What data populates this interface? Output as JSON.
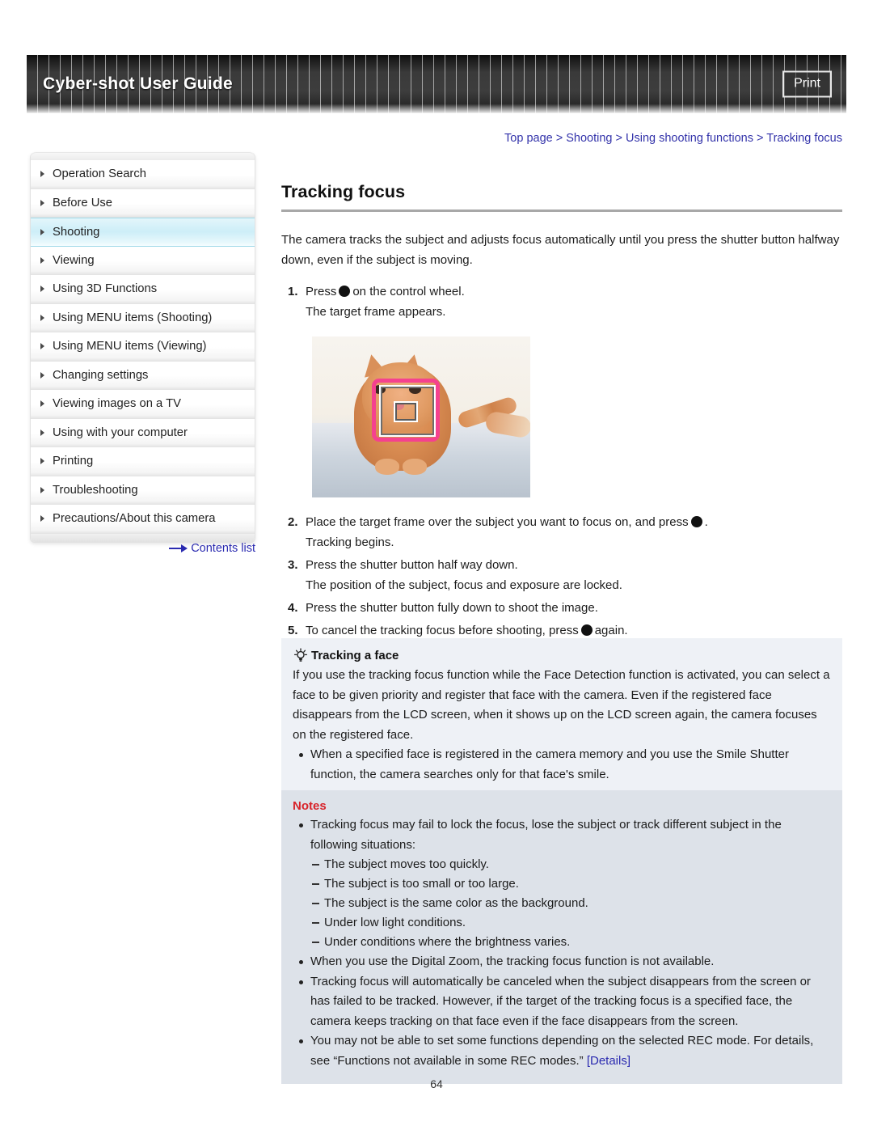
{
  "header": {
    "title": "Cyber-shot User Guide",
    "print_label": "Print"
  },
  "breadcrumb": {
    "text": "Top page > Shooting > Using shooting functions > Tracking focus"
  },
  "sidebar": {
    "items": [
      {
        "label": "Operation Search",
        "active": false
      },
      {
        "label": "Before Use",
        "active": false
      },
      {
        "label": "Shooting",
        "active": true
      },
      {
        "label": "Viewing",
        "active": false
      },
      {
        "label": "Using 3D Functions",
        "active": false
      },
      {
        "label": "Using MENU items (Shooting)",
        "active": false
      },
      {
        "label": "Using MENU items (Viewing)",
        "active": false
      },
      {
        "label": "Changing settings",
        "active": false
      },
      {
        "label": "Viewing images on a TV",
        "active": false
      },
      {
        "label": "Using with your computer",
        "active": false
      },
      {
        "label": "Printing",
        "active": false
      },
      {
        "label": "Troubleshooting",
        "active": false
      },
      {
        "label": "Precautions/About this camera",
        "active": false
      }
    ],
    "contents_link": "Contents list"
  },
  "main": {
    "title": "Tracking focus",
    "intro": "The camera tracks the subject and adjusts focus automatically until you press the shutter button halfway down, even if the subject is moving.",
    "step1": {
      "num": "1.",
      "before": "Press",
      "after": "on the control wheel.",
      "sub": "The target frame appears."
    },
    "step2": {
      "num": "2.",
      "before": "Place the target frame over the subject you want to focus on, and press",
      "after": ".",
      "sub": "Tracking begins."
    },
    "step3": {
      "num": "3.",
      "text": "Press the shutter button half way down.",
      "sub": "The position of the subject, focus and exposure are locked."
    },
    "step4": {
      "num": "4.",
      "text": "Press the shutter button fully down to shoot the image."
    },
    "step5": {
      "num": "5.",
      "before": "To cancel the tracking focus before shooting, press",
      "after": "again."
    },
    "photo_alt": "cat with tracking frame overlay"
  },
  "tip": {
    "heading": "Tracking a face",
    "body": "If you use the tracking focus function while the Face Detection function is activated, you can select a face to be given priority and register that face with the camera. Even if the registered face disappears from the LCD screen, when it shows up on the LCD screen again, the camera focuses on the registered face.",
    "bullets": [
      "When a specified face is registered in the camera memory and you use the Smile Shutter function, the camera searches only for that face's smile."
    ]
  },
  "notes": {
    "heading": "Notes",
    "item1": "Tracking focus may fail to lock the focus, lose the subject or track different subject in the following situations:",
    "sub_items": [
      "The subject moves too quickly.",
      "The subject is too small or too large.",
      "The subject is the same color as the background.",
      "Under low light conditions.",
      "Under conditions where the brightness varies."
    ],
    "item2": "When you use the Digital Zoom, the tracking focus function is not available.",
    "item3": "Tracking focus will automatically be canceled when the subject disappears from the screen or has failed to be tracked. However, if the target of the tracking focus is a specified face, the camera keeps tracking on that face even if the face disappears from the screen.",
    "item4_text": "You may not be able to set some functions depending on the selected REC mode. For details, see “Functions not available in some REC modes.”",
    "item4_link": "[Details]"
  },
  "footer": {
    "page_number": "64"
  },
  "colors": {
    "accent_link": "#2a2ab0",
    "notes_heading": "#d8232a",
    "frame_pink": "#f5418f",
    "sidebar_active": "#cdeef8"
  }
}
